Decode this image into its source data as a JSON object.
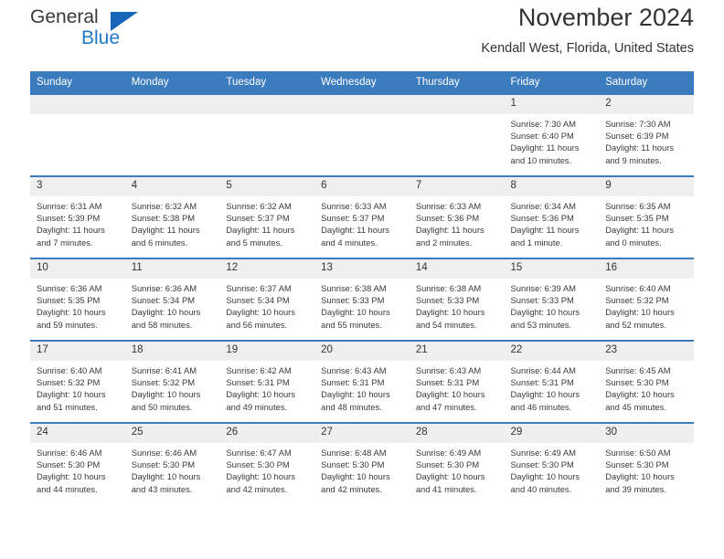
{
  "brand": {
    "name_top": "General",
    "name_bottom": "Blue",
    "triangle_color": "#1565b8",
    "text_color": "#3a3a3a",
    "blue_color": "#2079c8"
  },
  "header": {
    "title": "November 2024",
    "subtitle": "Kendall West, Florida, United States"
  },
  "theme": {
    "header_bg": "#3b7cbe",
    "date_band_bg": "#efefef",
    "cell_bg": "#ffffff",
    "text": "#333333"
  },
  "calendar": {
    "weekday_headers": [
      "Sunday",
      "Monday",
      "Tuesday",
      "Wednesday",
      "Thursday",
      "Friday",
      "Saturday"
    ],
    "weeks": [
      [
        {
          "date": "",
          "empty": true,
          "sunrise": "",
          "sunset": "",
          "daylight1": "",
          "daylight2": ""
        },
        {
          "date": "",
          "empty": true,
          "sunrise": "",
          "sunset": "",
          "daylight1": "",
          "daylight2": ""
        },
        {
          "date": "",
          "empty": true,
          "sunrise": "",
          "sunset": "",
          "daylight1": "",
          "daylight2": ""
        },
        {
          "date": "",
          "empty": true,
          "sunrise": "",
          "sunset": "",
          "daylight1": "",
          "daylight2": ""
        },
        {
          "date": "",
          "empty": true,
          "sunrise": "",
          "sunset": "",
          "daylight1": "",
          "daylight2": ""
        },
        {
          "date": "1",
          "empty": false,
          "sunrise": "Sunrise: 7:30 AM",
          "sunset": "Sunset: 6:40 PM",
          "daylight1": "Daylight: 11 hours",
          "daylight2": "and 10 minutes."
        },
        {
          "date": "2",
          "empty": false,
          "sunrise": "Sunrise: 7:30 AM",
          "sunset": "Sunset: 6:39 PM",
          "daylight1": "Daylight: 11 hours",
          "daylight2": "and 9 minutes."
        }
      ],
      [
        {
          "date": "3",
          "empty": false,
          "sunrise": "Sunrise: 6:31 AM",
          "sunset": "Sunset: 5:39 PM",
          "daylight1": "Daylight: 11 hours",
          "daylight2": "and 7 minutes."
        },
        {
          "date": "4",
          "empty": false,
          "sunrise": "Sunrise: 6:32 AM",
          "sunset": "Sunset: 5:38 PM",
          "daylight1": "Daylight: 11 hours",
          "daylight2": "and 6 minutes."
        },
        {
          "date": "5",
          "empty": false,
          "sunrise": "Sunrise: 6:32 AM",
          "sunset": "Sunset: 5:37 PM",
          "daylight1": "Daylight: 11 hours",
          "daylight2": "and 5 minutes."
        },
        {
          "date": "6",
          "empty": false,
          "sunrise": "Sunrise: 6:33 AM",
          "sunset": "Sunset: 5:37 PM",
          "daylight1": "Daylight: 11 hours",
          "daylight2": "and 4 minutes."
        },
        {
          "date": "7",
          "empty": false,
          "sunrise": "Sunrise: 6:33 AM",
          "sunset": "Sunset: 5:36 PM",
          "daylight1": "Daylight: 11 hours",
          "daylight2": "and 2 minutes."
        },
        {
          "date": "8",
          "empty": false,
          "sunrise": "Sunrise: 6:34 AM",
          "sunset": "Sunset: 5:36 PM",
          "daylight1": "Daylight: 11 hours",
          "daylight2": "and 1 minute."
        },
        {
          "date": "9",
          "empty": false,
          "sunrise": "Sunrise: 6:35 AM",
          "sunset": "Sunset: 5:35 PM",
          "daylight1": "Daylight: 11 hours",
          "daylight2": "and 0 minutes."
        }
      ],
      [
        {
          "date": "10",
          "empty": false,
          "sunrise": "Sunrise: 6:36 AM",
          "sunset": "Sunset: 5:35 PM",
          "daylight1": "Daylight: 10 hours",
          "daylight2": "and 59 minutes."
        },
        {
          "date": "11",
          "empty": false,
          "sunrise": "Sunrise: 6:36 AM",
          "sunset": "Sunset: 5:34 PM",
          "daylight1": "Daylight: 10 hours",
          "daylight2": "and 58 minutes."
        },
        {
          "date": "12",
          "empty": false,
          "sunrise": "Sunrise: 6:37 AM",
          "sunset": "Sunset: 5:34 PM",
          "daylight1": "Daylight: 10 hours",
          "daylight2": "and 56 minutes."
        },
        {
          "date": "13",
          "empty": false,
          "sunrise": "Sunrise: 6:38 AM",
          "sunset": "Sunset: 5:33 PM",
          "daylight1": "Daylight: 10 hours",
          "daylight2": "and 55 minutes."
        },
        {
          "date": "14",
          "empty": false,
          "sunrise": "Sunrise: 6:38 AM",
          "sunset": "Sunset: 5:33 PM",
          "daylight1": "Daylight: 10 hours",
          "daylight2": "and 54 minutes."
        },
        {
          "date": "15",
          "empty": false,
          "sunrise": "Sunrise: 6:39 AM",
          "sunset": "Sunset: 5:33 PM",
          "daylight1": "Daylight: 10 hours",
          "daylight2": "and 53 minutes."
        },
        {
          "date": "16",
          "empty": false,
          "sunrise": "Sunrise: 6:40 AM",
          "sunset": "Sunset: 5:32 PM",
          "daylight1": "Daylight: 10 hours",
          "daylight2": "and 52 minutes."
        }
      ],
      [
        {
          "date": "17",
          "empty": false,
          "sunrise": "Sunrise: 6:40 AM",
          "sunset": "Sunset: 5:32 PM",
          "daylight1": "Daylight: 10 hours",
          "daylight2": "and 51 minutes."
        },
        {
          "date": "18",
          "empty": false,
          "sunrise": "Sunrise: 6:41 AM",
          "sunset": "Sunset: 5:32 PM",
          "daylight1": "Daylight: 10 hours",
          "daylight2": "and 50 minutes."
        },
        {
          "date": "19",
          "empty": false,
          "sunrise": "Sunrise: 6:42 AM",
          "sunset": "Sunset: 5:31 PM",
          "daylight1": "Daylight: 10 hours",
          "daylight2": "and 49 minutes."
        },
        {
          "date": "20",
          "empty": false,
          "sunrise": "Sunrise: 6:43 AM",
          "sunset": "Sunset: 5:31 PM",
          "daylight1": "Daylight: 10 hours",
          "daylight2": "and 48 minutes."
        },
        {
          "date": "21",
          "empty": false,
          "sunrise": "Sunrise: 6:43 AM",
          "sunset": "Sunset: 5:31 PM",
          "daylight1": "Daylight: 10 hours",
          "daylight2": "and 47 minutes."
        },
        {
          "date": "22",
          "empty": false,
          "sunrise": "Sunrise: 6:44 AM",
          "sunset": "Sunset: 5:31 PM",
          "daylight1": "Daylight: 10 hours",
          "daylight2": "and 46 minutes."
        },
        {
          "date": "23",
          "empty": false,
          "sunrise": "Sunrise: 6:45 AM",
          "sunset": "Sunset: 5:30 PM",
          "daylight1": "Daylight: 10 hours",
          "daylight2": "and 45 minutes."
        }
      ],
      [
        {
          "date": "24",
          "empty": false,
          "sunrise": "Sunrise: 6:46 AM",
          "sunset": "Sunset: 5:30 PM",
          "daylight1": "Daylight: 10 hours",
          "daylight2": "and 44 minutes."
        },
        {
          "date": "25",
          "empty": false,
          "sunrise": "Sunrise: 6:46 AM",
          "sunset": "Sunset: 5:30 PM",
          "daylight1": "Daylight: 10 hours",
          "daylight2": "and 43 minutes."
        },
        {
          "date": "26",
          "empty": false,
          "sunrise": "Sunrise: 6:47 AM",
          "sunset": "Sunset: 5:30 PM",
          "daylight1": "Daylight: 10 hours",
          "daylight2": "and 42 minutes."
        },
        {
          "date": "27",
          "empty": false,
          "sunrise": "Sunrise: 6:48 AM",
          "sunset": "Sunset: 5:30 PM",
          "daylight1": "Daylight: 10 hours",
          "daylight2": "and 42 minutes."
        },
        {
          "date": "28",
          "empty": false,
          "sunrise": "Sunrise: 6:49 AM",
          "sunset": "Sunset: 5:30 PM",
          "daylight1": "Daylight: 10 hours",
          "daylight2": "and 41 minutes."
        },
        {
          "date": "29",
          "empty": false,
          "sunrise": "Sunrise: 6:49 AM",
          "sunset": "Sunset: 5:30 PM",
          "daylight1": "Daylight: 10 hours",
          "daylight2": "and 40 minutes."
        },
        {
          "date": "30",
          "empty": false,
          "sunrise": "Sunrise: 6:50 AM",
          "sunset": "Sunset: 5:30 PM",
          "daylight1": "Daylight: 10 hours",
          "daylight2": "and 39 minutes."
        }
      ]
    ]
  }
}
